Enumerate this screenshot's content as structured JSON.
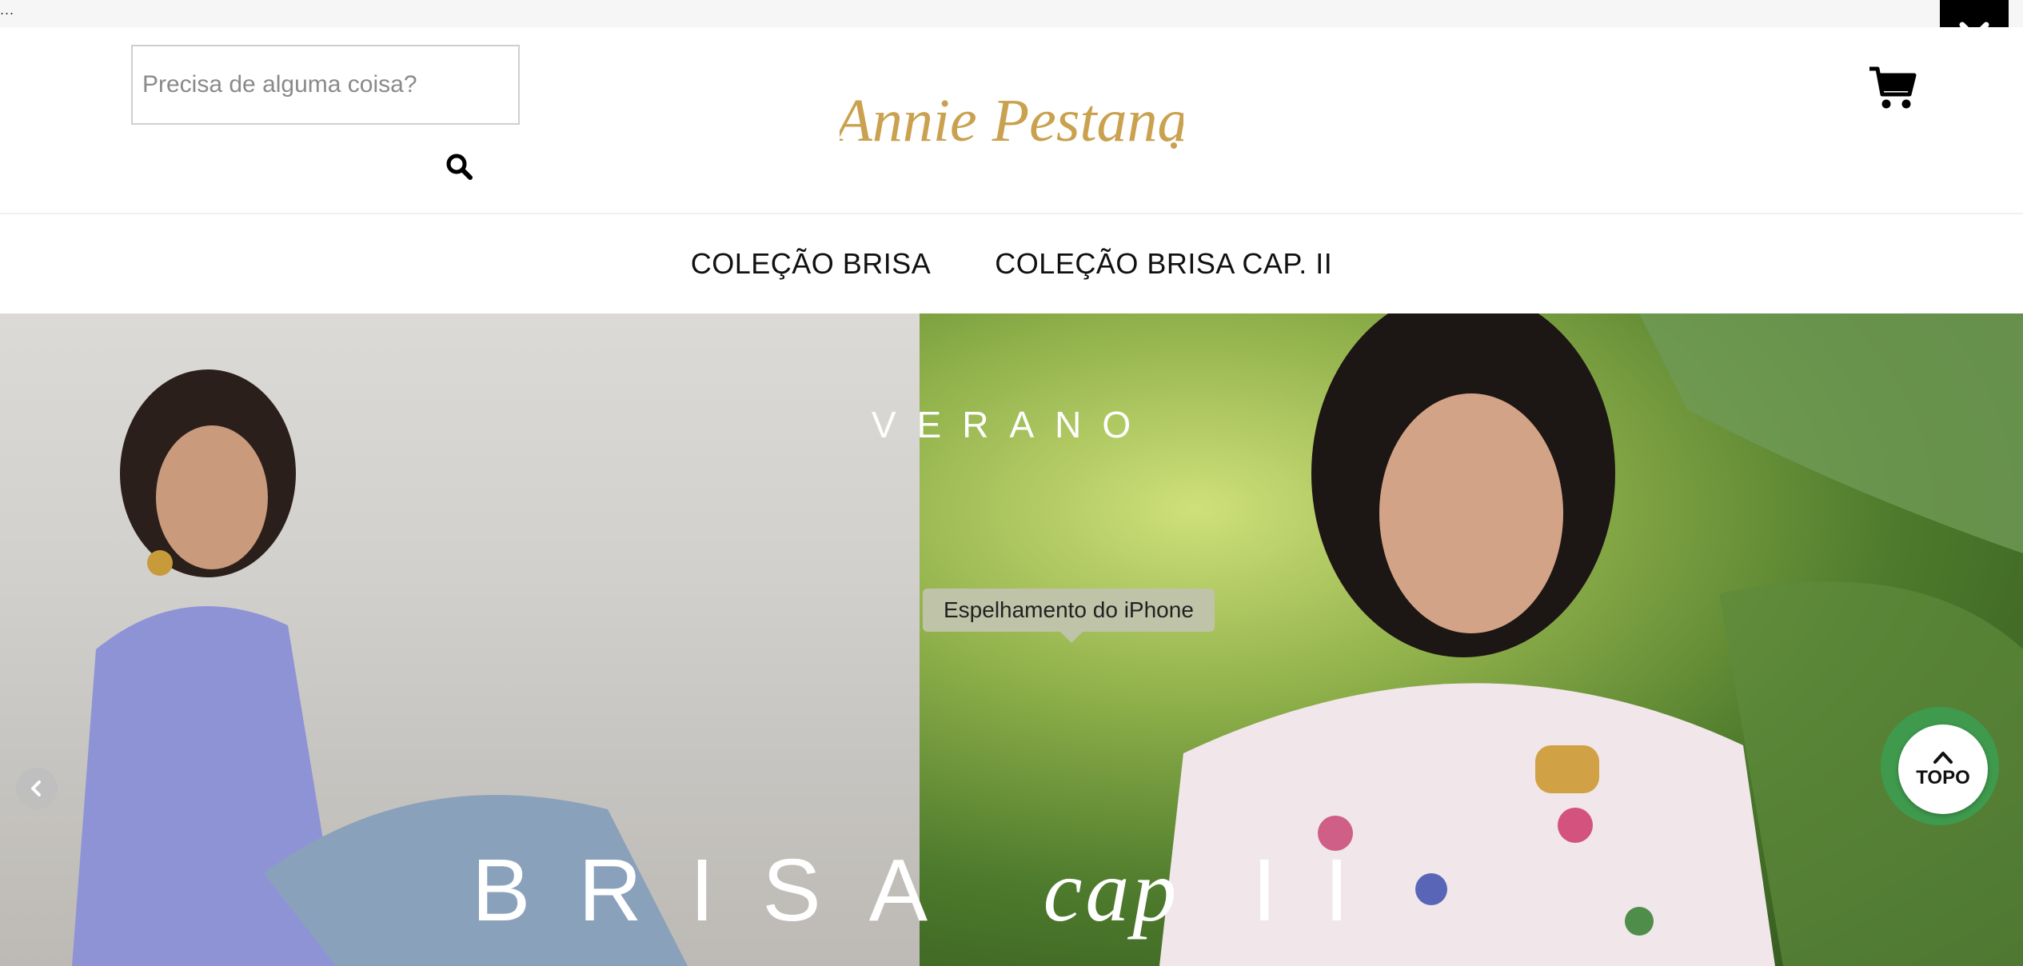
{
  "top_strip": {
    "ellipsis": "..."
  },
  "header": {
    "search": {
      "placeholder": "Precisa de alguma coisa?",
      "value": ""
    },
    "logo_text": "Annie Pestana"
  },
  "icons": {
    "dropdown": "chevron-down-icon",
    "search": "search-icon",
    "cart": "cart-icon",
    "prev": "chevron-left-icon",
    "topo": "chevron-up-icon"
  },
  "nav": {
    "items": [
      {
        "label": "COLEÇÃO BRISA"
      },
      {
        "label": "COLEÇÃO BRISA CAP. II"
      }
    ]
  },
  "hero": {
    "title_top": "VERANO",
    "title_bottom_main": "BRISA",
    "title_bottom_cap": "cap",
    "title_bottom_num": "II"
  },
  "topo_button": {
    "label": "TOPO"
  },
  "tooltip": {
    "text": "Espelhamento do iPhone"
  },
  "colors": {
    "accent_gold": "#c9a14f",
    "topo_green": "#3f9a4d",
    "black": "#000000"
  }
}
